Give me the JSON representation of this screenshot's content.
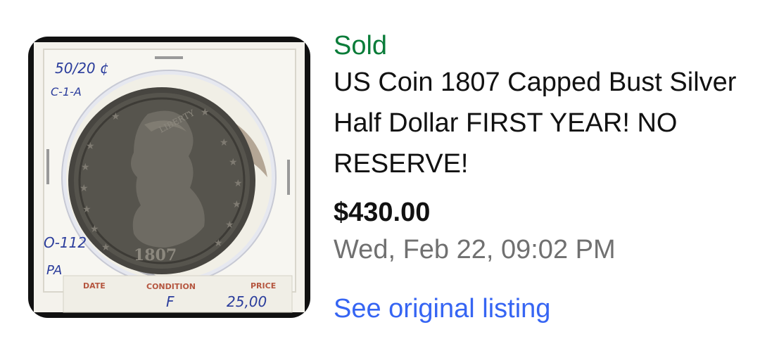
{
  "item": {
    "status": "Sold",
    "title": "US Coin 1807 Capped Bust Silver Half Dollar FIRST YEAR! NO RESERVE!",
    "price": "$430.00",
    "sold_date": "Wed, Feb 22, 09:02 PM",
    "link_label": "See original listing"
  },
  "coin_holder": {
    "note_top": "50/20 ¢",
    "note_variety": "C-1-A",
    "note_overton": "O-112",
    "note_grade_tag": "PA",
    "label_date": "DATE",
    "label_condition": "CONDITION",
    "label_price": "PRICE",
    "condition_value": "F",
    "price_value": "25,00",
    "coin_liberty": "LIBERTY",
    "coin_year": "1807"
  },
  "colors": {
    "status_green": "#0a7c39",
    "link_blue": "#3665f3",
    "date_gray": "#707070",
    "ink_blue": "#2b3d9c",
    "label_red": "#b5563f"
  }
}
